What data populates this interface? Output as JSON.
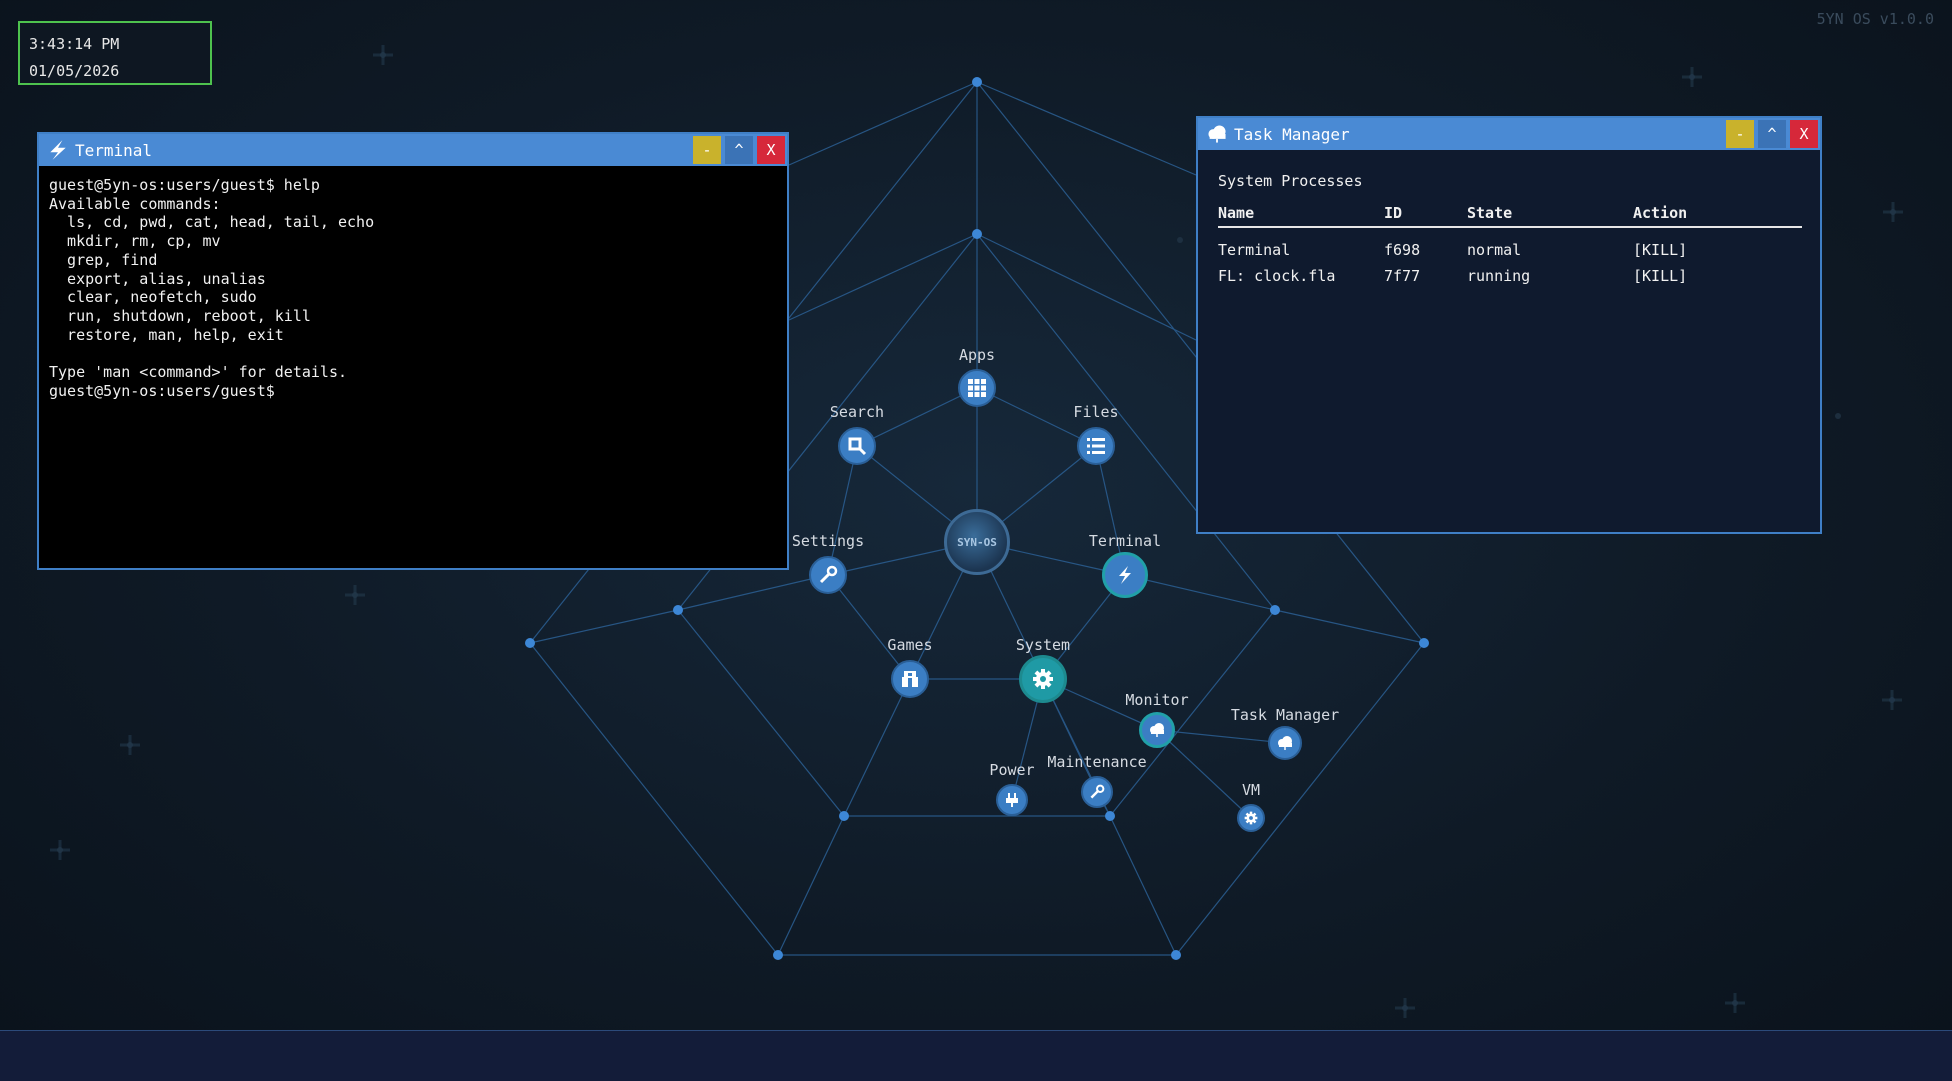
{
  "system": {
    "time": "3:43:14 PM",
    "date": "01/05/2026",
    "version": "5YN OS v1.0.0",
    "logo_text": "SYN-OS"
  },
  "terminal": {
    "title": "Terminal",
    "buttons": {
      "minimize": "-",
      "maximize": "^",
      "close": "X"
    },
    "output": "guest@5yn-os:users/guest$ help\nAvailable commands:\n  ls, cd, pwd, cat, head, tail, echo\n  mkdir, rm, cp, mv\n  grep, find\n  export, alias, unalias\n  clear, neofetch, sudo\n  run, shutdown, reboot, kill\n  restore, man, help, exit\n\nType 'man <command>' for details.\nguest@5yn-os:users/guest$"
  },
  "task_manager": {
    "title": "Task Manager",
    "buttons": {
      "minimize": "-",
      "maximize": "^",
      "close": "X"
    },
    "heading": "System Processes",
    "columns": [
      "Name",
      "ID",
      "State",
      "Action"
    ],
    "processes": [
      {
        "name": "Terminal",
        "id": "f698",
        "state": "normal",
        "action": "[KILL]"
      },
      {
        "name": "FL: clock.fla",
        "id": "7f77",
        "state": "running",
        "action": "[KILL]"
      }
    ]
  },
  "desktop": {
    "nodes": {
      "apps": {
        "label": "Apps",
        "icon": "grid-icon"
      },
      "search": {
        "label": "Search",
        "icon": "search-icon"
      },
      "files": {
        "label": "Files",
        "icon": "list-icon"
      },
      "settings": {
        "label": "Settings",
        "icon": "wrench-icon"
      },
      "terminal": {
        "label": "Terminal",
        "icon": "lightning-icon"
      },
      "games": {
        "label": "Games",
        "icon": "controller-icon"
      },
      "system": {
        "label": "System",
        "icon": "gear-icon"
      },
      "monitor": {
        "label": "Monitor",
        "icon": "cloud-icon"
      },
      "task_manager": {
        "label": "Task Manager",
        "icon": "cloud-icon"
      },
      "maintenance": {
        "label": "Maintenance",
        "icon": "wrench-icon"
      },
      "power": {
        "label": "Power",
        "icon": "plug-icon"
      },
      "vm": {
        "label": "VM",
        "icon": "gear-icon"
      }
    }
  },
  "colors": {
    "accent": "#4a8ad4",
    "clock_border": "#4ec24e",
    "kill": "#e02a3b",
    "node": "#3b7ec4",
    "node_active": "#21a0a8"
  }
}
